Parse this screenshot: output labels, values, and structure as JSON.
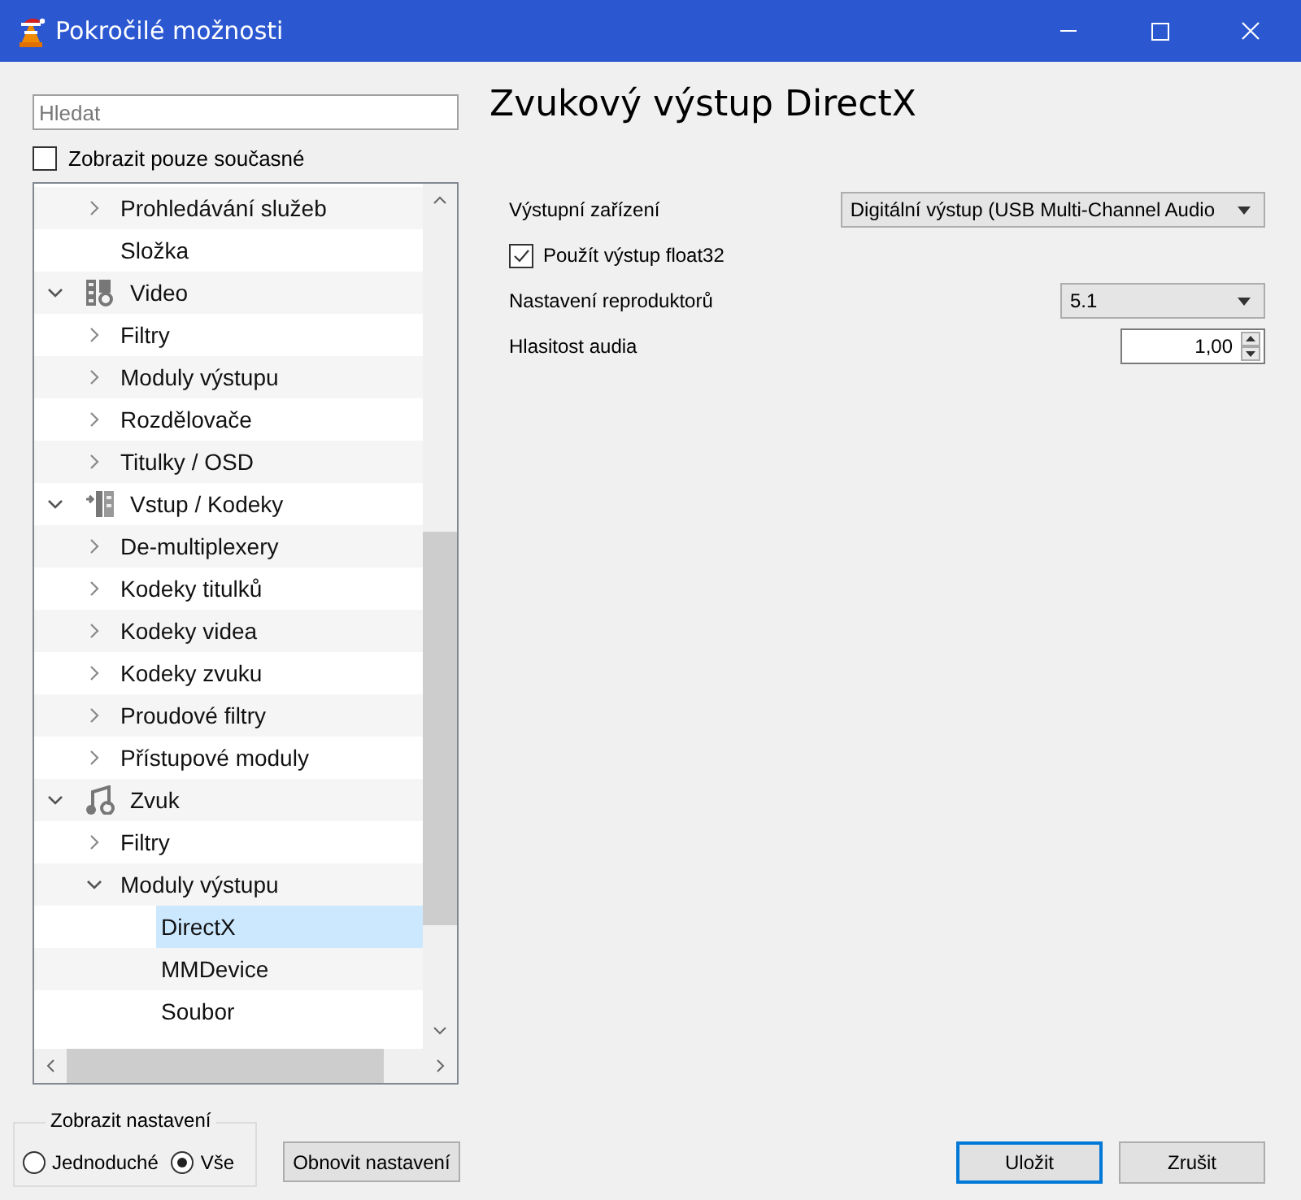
{
  "window": {
    "title": "Pokročilé možnosti"
  },
  "search": {
    "placeholder": "Hledat"
  },
  "only_current": {
    "label": "Zobrazit pouze současné",
    "checked": false
  },
  "tree": [
    {
      "children": [
        {
          "label": "Prohledávání služeb",
          "kind": "folder",
          "expanded": false,
          "selected": false
        },
        {
          "label": "Složka",
          "kind": "leaf",
          "selected": false
        }
      ]
    },
    {
      "label": "Video",
      "kind": "category",
      "expanded": true,
      "selected": false,
      "children": [
        {
          "label": "Filtry",
          "kind": "folder",
          "expanded": false,
          "selected": false
        },
        {
          "label": "Moduly výstupu",
          "kind": "folder",
          "expanded": false,
          "selected": false
        },
        {
          "label": "Rozdělovače",
          "kind": "folder",
          "expanded": false,
          "selected": false
        },
        {
          "label": "Titulky / OSD",
          "kind": "folder",
          "expanded": false,
          "selected": false
        }
      ]
    },
    {
      "label": "Vstup / Kodeky",
      "kind": "category",
      "expanded": true,
      "selected": false,
      "children": [
        {
          "label": "De-multiplexery",
          "kind": "folder",
          "expanded": false,
          "selected": false
        },
        {
          "label": "Kodeky titulků",
          "kind": "folder",
          "expanded": false,
          "selected": false
        },
        {
          "label": "Kodeky videa",
          "kind": "folder",
          "expanded": false,
          "selected": false
        },
        {
          "label": "Kodeky zvuku",
          "kind": "folder",
          "expanded": false,
          "selected": false
        },
        {
          "label": "Proudové filtry",
          "kind": "folder",
          "expanded": false,
          "selected": false
        },
        {
          "label": "Přístupové moduly",
          "kind": "folder",
          "expanded": false,
          "selected": false
        }
      ]
    },
    {
      "label": "Zvuk",
      "kind": "category",
      "expanded": true,
      "selected": false,
      "children": [
        {
          "label": "Filtry",
          "kind": "folder",
          "expanded": false,
          "selected": false
        },
        {
          "label": "Moduly výstupu",
          "kind": "folder",
          "expanded": true,
          "selected": false,
          "children": [
            {
              "label": "DirectX",
              "kind": "leaf",
              "selected": true
            },
            {
              "label": "MMDevice",
              "kind": "leaf",
              "selected": false
            },
            {
              "label": "Soubor",
              "kind": "leaf",
              "selected": false
            }
          ]
        }
      ]
    }
  ],
  "panel": {
    "title": "Zvukový výstup DirectX",
    "settings": [
      {
        "kind": "dropdown",
        "label": "Výstupní zařízení",
        "value": "Digitální výstup (USB Multi-Channel Audio"
      },
      {
        "kind": "checkbox",
        "label": "Použít výstup float32",
        "checked": true
      },
      {
        "kind": "dropdown",
        "label": "Nastavení reproduktorů",
        "value": "5.1"
      },
      {
        "kind": "spinbox",
        "label": "Hlasitost audia",
        "value": "1,00"
      }
    ]
  },
  "view_mode": {
    "legend": "Zobrazit nastavení",
    "options": [
      {
        "label": "Jednoduché",
        "selected": false
      },
      {
        "label": "Vše",
        "selected": true
      }
    ]
  },
  "reset_button": {
    "label": "Obnovit nastavení"
  },
  "buttons": [
    {
      "label": "Uložit",
      "focused": true
    },
    {
      "label": "Zrušit",
      "focused": false
    }
  ]
}
